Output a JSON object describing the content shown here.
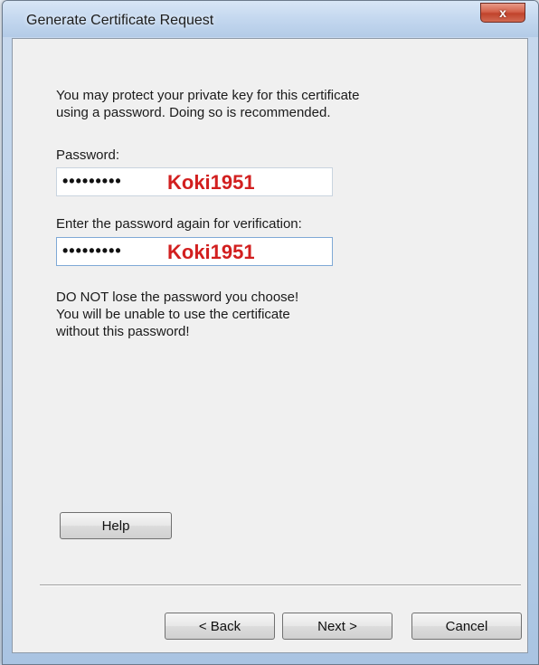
{
  "window": {
    "title": "Generate Certificate Request",
    "close_label": "x"
  },
  "content": {
    "intro_line1": "You may protect your private key for this certificate",
    "intro_line2": "using a password. Doing so is recommended.",
    "password_label": "Password:",
    "password_masked": "•••••••••",
    "password_annotation": "Koki1951",
    "verify_label": "Enter the password again for verification:",
    "verify_masked": "•••••••••",
    "verify_annotation": "Koki1951",
    "warning_line1": "DO NOT lose the password you choose!",
    "warning_line2": "You will be unable to use the certificate",
    "warning_line3": "without this password!"
  },
  "buttons": {
    "help": "Help",
    "back": "< Back",
    "next": "Next >",
    "cancel": "Cancel"
  },
  "colors": {
    "annotation": "#d21f1f",
    "close_button": "#c7432c",
    "dialog_background": "#f0f0f0"
  }
}
